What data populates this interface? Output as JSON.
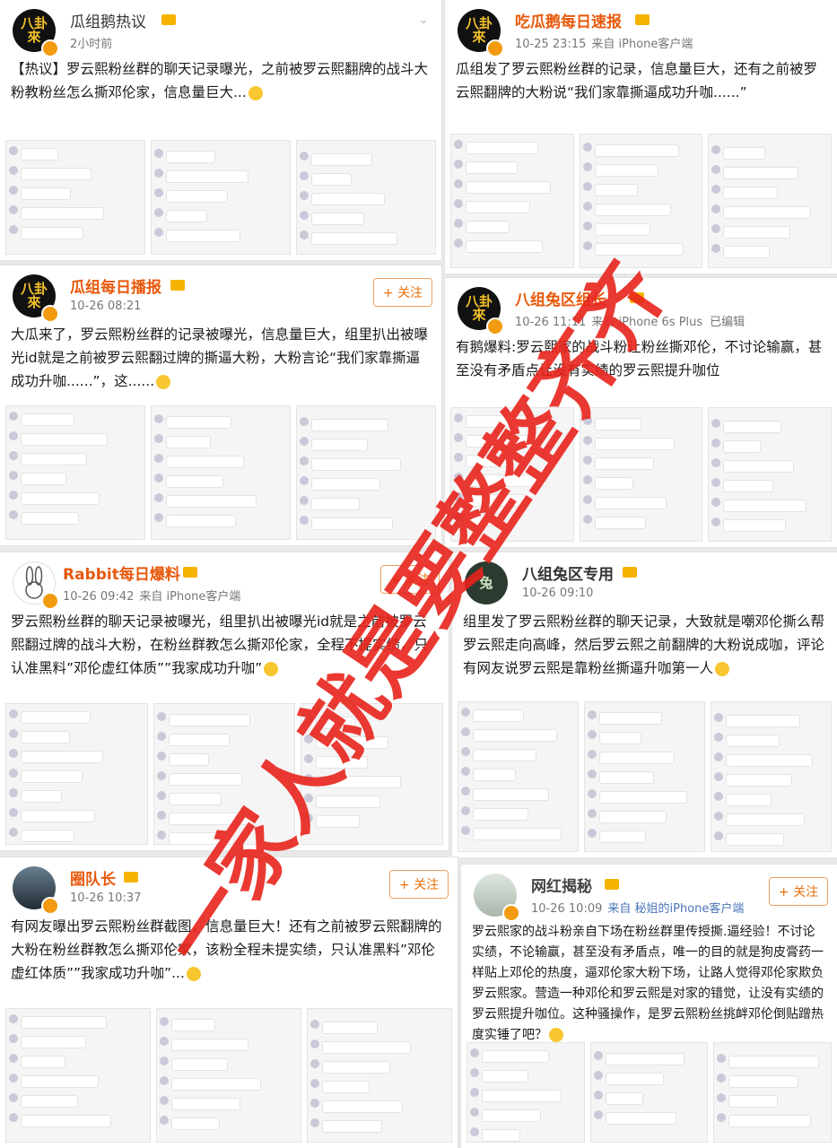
{
  "posts": [
    {
      "name": "瓜组鹅热议",
      "time": "2小时前",
      "source": "",
      "follow": "",
      "text": "【热议】罗云熙粉丝群的聊天记录曝光，之前被罗云熙翻牌的战斗大粉教粉丝怎么撕邓伦家，信息量巨大..."
    },
    {
      "name": "吃瓜鹅每日速报",
      "time": "10-25 23:15",
      "source": "来自 iPhone客户端",
      "follow": "",
      "text": "瓜组发了罗云熙粉丝群的记录，信息量巨大，还有之前被罗云熙翻牌的大粉说“我们家靠撕逼成功升咖......”"
    },
    {
      "name": "瓜组每日播报",
      "time": "10-26 08:21",
      "source": "",
      "follow": "+ 关注",
      "text": "大瓜来了，罗云熙粉丝群的记录被曝光，信息量巨大，组里扒出被曝光id就是之前被罗云熙翻过牌的撕逼大粉，大粉言论“我们家靠撕逼成功升咖......”，这......"
    },
    {
      "name": "八组兔区组长",
      "time": "10-26 11:11",
      "source": "来自 iPhone 6s Plus",
      "edited": "已编辑",
      "follow": "",
      "text": "有鹅爆料:罗云熙家的战斗粉让粉丝撕邓伦，不讨论输赢，甚至没有矛盾点让没有实绩的罗云熙提升咖位"
    },
    {
      "name": "Rabbit每日爆料",
      "time": "10-26 09:42",
      "source": "来自 iPhone客户端",
      "follow": "+ 关注",
      "text": "罗云熙粉丝群的聊天记录被曝光，组里扒出被曝光id就是之前被罗云熙翻过牌的战斗大粉，在粉丝群教怎么撕邓伦家，全程不提实绩，只认准黑料”邓伦虚红体质””我家成功升咖”"
    },
    {
      "name": "八组兔区专用",
      "time": "10-26 09:10",
      "source": "",
      "follow": "",
      "text": "组里发了罗云熙粉丝群的聊天记录，大致就是嘲邓伦撕么帮罗云熙走向高峰，然后罗云熙之前翻牌的大粉说成咖，评论有网友说罗云熙是靠粉丝撕逼升咖第一人"
    },
    {
      "name": "圈队长",
      "time": "10-26 10:37",
      "source": "",
      "follow": "+ 关注",
      "text": "有网友曝出罗云熙粉丝群截图，信息量巨大！还有之前被罗云熙翻牌的大粉在粉丝群教怎么撕邓伦家，该粉全程未提实绩，只认准黑料”邓伦虚红体质””我家成功升咖”..."
    },
    {
      "name": "网红揭秘",
      "time": "10-26 10:09",
      "source": "来自 秘姐的iPhone客户端",
      "follow": "+ 关注",
      "text": "罗云熙家的战斗粉亲自下场在粉丝群里传授撕.逼经验！不讨论实绩，不论输赢，甚至没有矛盾点，唯一的目的就是狗皮膏药一样贴上邓伦的热度，逼邓伦家大粉下场，让路人觉得邓伦家欺负罗云熙家。营造一种邓伦和罗云熙是对家的错觉，让没有实绩的罗云熙提升咖位。这种骚操作，是罗云熙粉丝挑衅邓伦倒贴蹭热度实锤了吧？"
    }
  ],
  "overlay": {
    "text": "一家人就是要整整齐齐",
    "color": "#e8231c"
  }
}
